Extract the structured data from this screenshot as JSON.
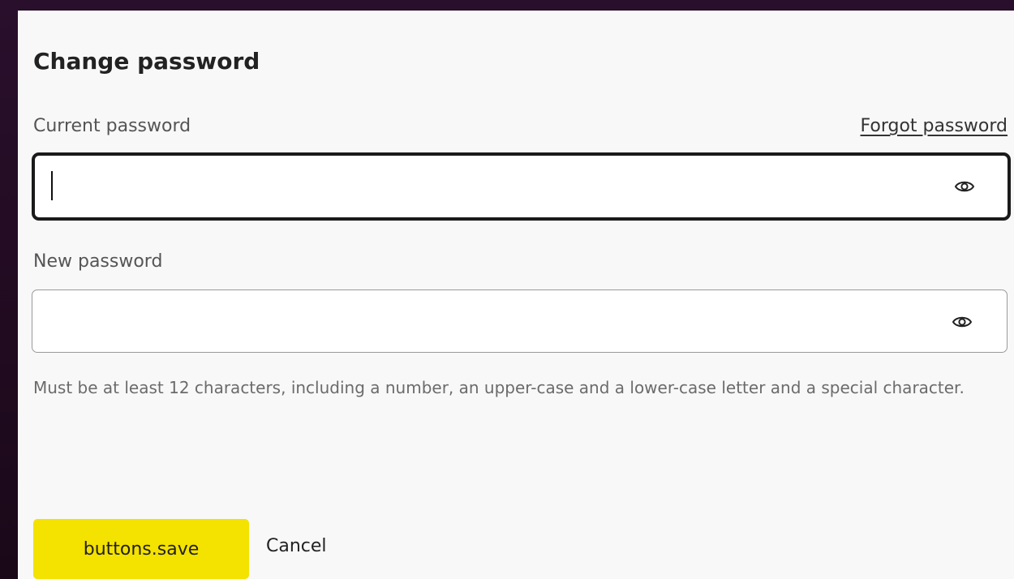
{
  "dialog": {
    "title": "Change password",
    "current_password": {
      "label": "Current password",
      "value": "",
      "placeholder": "",
      "toggle_icon": "eye-icon",
      "forgot_link": "Forgot password"
    },
    "new_password": {
      "label": "New password",
      "value": "",
      "placeholder": "",
      "toggle_icon": "eye-icon",
      "hint": "Must be at least 12 characters, including a number, an upper-case and a lower-case letter and a special character."
    },
    "buttons": {
      "save_label": "buttons.save",
      "cancel_label": "Cancel"
    }
  },
  "colors": {
    "backdrop": "#1e0a1e",
    "panel": "#f8f8f8",
    "primary_button": "#f4e200",
    "focused_border": "#1a1a1a",
    "hint_text": "#6b6b6b"
  }
}
